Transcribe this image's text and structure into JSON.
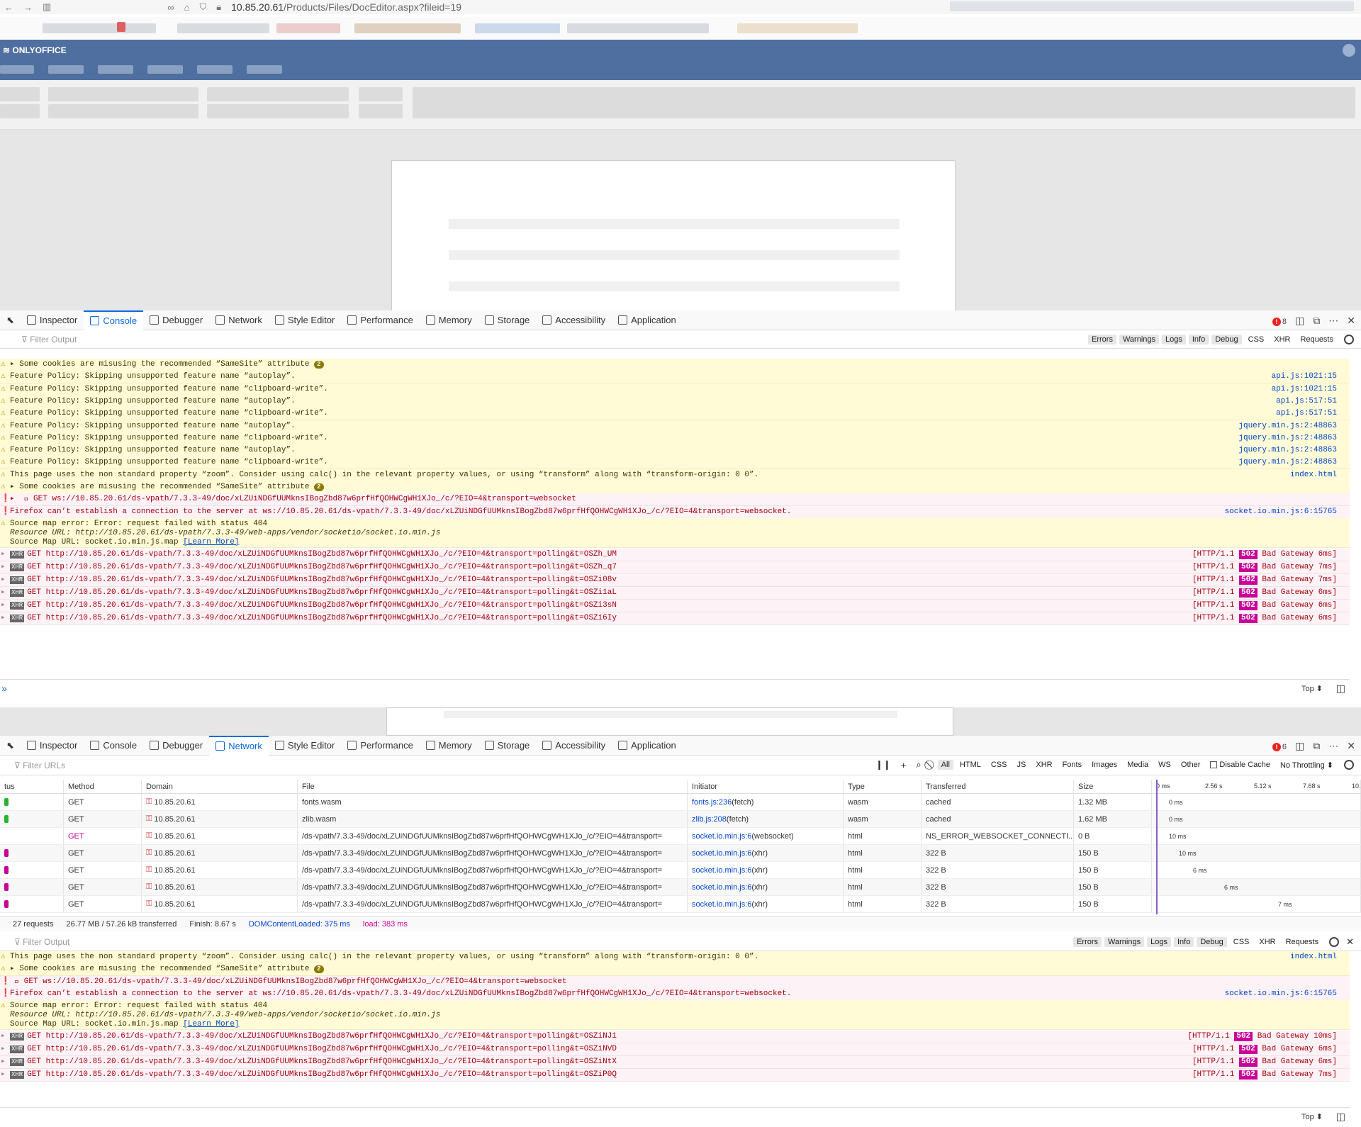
{
  "browser": {
    "url_host": "10.85.20.61",
    "url_path": "/Products/Files/DocEditor.aspx?fileid=19"
  },
  "app": {
    "brand": "ONLYOFFICE"
  },
  "devtools_tabs": [
    {
      "label": "Inspector",
      "icon": "inspector-icon"
    },
    {
      "label": "Console",
      "icon": "console-icon"
    },
    {
      "label": "Debugger",
      "icon": "debugger-icon"
    },
    {
      "label": "Network",
      "icon": "network-icon"
    },
    {
      "label": "Style Editor",
      "icon": "style-editor-icon"
    },
    {
      "label": "Performance",
      "icon": "performance-icon"
    },
    {
      "label": "Memory",
      "icon": "memory-icon"
    },
    {
      "label": "Storage",
      "icon": "storage-icon"
    },
    {
      "label": "Accessibility",
      "icon": "accessibility-icon"
    },
    {
      "label": "Application",
      "icon": "application-icon"
    }
  ],
  "console1": {
    "error_count": "8",
    "filter_placeholder": "Filter Output",
    "filter_buttons": [
      "Errors",
      "Warnings",
      "Logs",
      "Info",
      "Debug"
    ],
    "filter_plain": [
      "CSS",
      "XHR",
      "Requests"
    ],
    "rows": [
      {
        "type": "warn",
        "text": "▸ Some cookies are misusing the recommended “SameSite” attribute ",
        "badge": "2",
        "src": ""
      },
      {
        "type": "warn",
        "text": "Feature Policy: Skipping unsupported feature name “autoplay”.",
        "src": "api.js:1021:15"
      },
      {
        "type": "warn",
        "text": "Feature Policy: Skipping unsupported feature name “clipboard-write”.",
        "src": "api.js:1021:15"
      },
      {
        "type": "warn",
        "text": "Feature Policy: Skipping unsupported feature name “autoplay”.",
        "src": "api.js:517:51"
      },
      {
        "type": "warn",
        "text": "Feature Policy: Skipping unsupported feature name “clipboard-write”.",
        "src": "api.js:517:51"
      },
      {
        "type": "warn",
        "text": "Feature Policy: Skipping unsupported feature name “autoplay”.",
        "src": "jquery.min.js:2:48863"
      },
      {
        "type": "warn",
        "text": "Feature Policy: Skipping unsupported feature name “clipboard-write”.",
        "src": "jquery.min.js:2:48863"
      },
      {
        "type": "warn",
        "text": "Feature Policy: Skipping unsupported feature name “autoplay”.",
        "src": "jquery.min.js:2:48863"
      },
      {
        "type": "warn",
        "text": "Feature Policy: Skipping unsupported feature name “clipboard-write”.",
        "src": "jquery.min.js:2:48863"
      },
      {
        "type": "warn",
        "text": "This page uses the non standard property “zoom”. Consider using calc() in the relevant property values, or using “transform” along with “transform-origin: 0 0”.",
        "src": "index.html"
      },
      {
        "type": "warn",
        "text": "▸ Some cookies are misusing the recommended “SameSite” attribute ",
        "badge": "2",
        "src": ""
      },
      {
        "type": "err",
        "text": "▸  ⃠ GET ws://10.85.20.61/ds-vpath/7.3.3-49/doc/xLZUiNDGfUUMknsIBogZbd87w6prfHfQOHWCgWH1XJo_/c/?EIO=4&transport=websocket",
        "src": ""
      },
      {
        "type": "err",
        "text": "Firefox can’t establish a connection to the server at ws://10.85.20.61/ds-vpath/7.3.3-49/doc/xLZUiNDGfUUMknsIBogZbd87w6prfHfQOHWCgWH1XJo_/c/?EIO=4&transport=websocket.",
        "src": "socket.io.min.js:6:15765"
      }
    ],
    "sourcemap": {
      "l1": "Source map error: Error: request failed with status 404",
      "l2": "Resource URL: http://10.85.20.61/ds-vpath/7.3.3-49/web-apps/vendor/socketio/socket.io.min.js",
      "l3": "Source Map URL: socket.io.min.js.map ",
      "learn": "[Learn More]"
    },
    "xhr": [
      {
        "url": "GET http://10.85.20.61/ds-vpath/7.3.3-49/doc/xLZUiNDGfUUMknsIBogZbd87w6prfHfQOHWCgWH1XJo_/c/?EIO=4&transport=polling&t=OSZh_UM",
        "status": "[HTTP/1.1 ",
        "code": "502",
        "tail": " Bad Gateway 6ms]"
      },
      {
        "url": "GET http://10.85.20.61/ds-vpath/7.3.3-49/doc/xLZUiNDGfUUMknsIBogZbd87w6prfHfQOHWCgWH1XJo_/c/?EIO=4&transport=polling&t=OSZh_q7",
        "status": "[HTTP/1.1 ",
        "code": "502",
        "tail": " Bad Gateway 7ms]"
      },
      {
        "url": "GET http://10.85.20.61/ds-vpath/7.3.3-49/doc/xLZUiNDGfUUMknsIBogZbd87w6prfHfQOHWCgWH1XJo_/c/?EIO=4&transport=polling&t=OSZi08v",
        "status": "[HTTP/1.1 ",
        "code": "502",
        "tail": " Bad Gateway 7ms]"
      },
      {
        "url": "GET http://10.85.20.61/ds-vpath/7.3.3-49/doc/xLZUiNDGfUUMknsIBogZbd87w6prfHfQOHWCgWH1XJo_/c/?EIO=4&transport=polling&t=OSZi1aL",
        "status": "[HTTP/1.1 ",
        "code": "502",
        "tail": " Bad Gateway 6ms]"
      },
      {
        "url": "GET http://10.85.20.61/ds-vpath/7.3.3-49/doc/xLZUiNDGfUUMknsIBogZbd87w6prfHfQOHWCgWH1XJo_/c/?EIO=4&transport=polling&t=OSZi3sN",
        "status": "[HTTP/1.1 ",
        "code": "502",
        "tail": " Bad Gateway 6ms]"
      },
      {
        "url": "GET http://10.85.20.61/ds-vpath/7.3.3-49/doc/xLZUiNDGfUUMknsIBogZbd87w6prfHfQOHWCgWH1XJo_/c/?EIO=4&transport=polling&t=OSZi6Iy",
        "status": "[HTTP/1.1 ",
        "code": "502",
        "tail": " Bad Gateway 6ms]"
      }
    ],
    "top_label": "Top ⬍"
  },
  "network": {
    "error_count": "6",
    "filter_placeholder": "Filter URLs",
    "type_filters": [
      "All",
      "HTML",
      "CSS",
      "JS",
      "XHR",
      "Fonts",
      "Images",
      "Media",
      "WS",
      "Other"
    ],
    "disable_cache": "Disable Cache",
    "throttling": "No Throttling ⬍",
    "columns": [
      "tus",
      "Method",
      "Domain",
      "File",
      "Initiator",
      "Type",
      "Transferred",
      "Size"
    ],
    "timeline_ticks": [
      "0 ms",
      "2.56 s",
      "5.12 s",
      "7.68 s",
      "10.24"
    ],
    "rows": [
      {
        "method": "GET",
        "domain": "10.85.20.61",
        "file": "fonts.wasm",
        "initiator": "fonts.js:236",
        "initiator_kind": " (fetch)",
        "type": "wasm",
        "transferred": "cached",
        "size": "1.32 MB",
        "time": "0 ms",
        "status_color": "#2cb32c"
      },
      {
        "method": "GET",
        "domain": "10.85.20.61",
        "file": "zlib.wasm",
        "initiator": "zlib.js:208",
        "initiator_kind": " (fetch)",
        "type": "wasm",
        "transferred": "cached",
        "size": "1.62 MB",
        "time": "0 ms",
        "status_color": "#2cb32c"
      },
      {
        "method": "GET",
        "domain": "10.85.20.61",
        "file": "/ds-vpath/7.3.3-49/doc/xLZUiNDGfUUMknsIBogZbd87w6prfHfQOHWCgWH1XJo_/c/?EIO=4&transport=",
        "initiator": "socket.io.min.js:6",
        "initiator_kind": " (websocket)",
        "type": "html",
        "transferred": "NS_ERROR_WEBSOCKET_CONNECTI...",
        "size": "0 B",
        "time": "10 ms",
        "status_color": "",
        "red": true
      },
      {
        "method": "GET",
        "domain": "10.85.20.61",
        "file": "/ds-vpath/7.3.3-49/doc/xLZUiNDGfUUMknsIBogZbd87w6prfHfQOHWCgWH1XJo_/c/?EIO=4&transport=",
        "initiator": "socket.io.min.js:6",
        "initiator_kind": " (xhr)",
        "type": "html",
        "transferred": "322 B",
        "size": "150 B",
        "time": "10 ms",
        "status_color": "#c80099"
      },
      {
        "method": "GET",
        "domain": "10.85.20.61",
        "file": "/ds-vpath/7.3.3-49/doc/xLZUiNDGfUUMknsIBogZbd87w6prfHfQOHWCgWH1XJo_/c/?EIO=4&transport=",
        "initiator": "socket.io.min.js:6",
        "initiator_kind": " (xhr)",
        "type": "html",
        "transferred": "322 B",
        "size": "150 B",
        "time": "6 ms",
        "status_color": "#c80099"
      },
      {
        "method": "GET",
        "domain": "10.85.20.61",
        "file": "/ds-vpath/7.3.3-49/doc/xLZUiNDGfUUMknsIBogZbd87w6prfHfQOHWCgWH1XJo_/c/?EIO=4&transport=",
        "initiator": "socket.io.min.js:6",
        "initiator_kind": " (xhr)",
        "type": "html",
        "transferred": "322 B",
        "size": "150 B",
        "time": "6 ms",
        "status_color": "#c80099"
      },
      {
        "method": "GET",
        "domain": "10.85.20.61",
        "file": "/ds-vpath/7.3.3-49/doc/xLZUiNDGfUUMknsIBogZbd87w6prfHfQOHWCgWH1XJo_/c/?EIO=4&transport=",
        "initiator": "socket.io.min.js:6",
        "initiator_kind": " (xhr)",
        "type": "html",
        "transferred": "322 B",
        "size": "150 B",
        "time": "7 ms",
        "status_color": "#c80099"
      }
    ],
    "summary": {
      "requests": "27 requests",
      "transferred": "26.77 MB / 57.26 kB transferred",
      "finish": "Finish: 8.67 s",
      "dcl": "DOMContentLoaded: 375 ms",
      "load": "load: 383 ms"
    }
  },
  "console2": {
    "filter_placeholder": "Filter Output",
    "rows": [
      {
        "type": "warn",
        "text": "This page uses the non standard property “zoom”. Consider using calc() in the relevant property values, or using “transform” along with “transform-origin: 0 0”.",
        "src": "index.html"
      },
      {
        "type": "warn",
        "text": "▸ Some cookies are misusing the recommended “SameSite” attribute ",
        "badge": "2",
        "src": ""
      },
      {
        "type": "err",
        "text": " ⃠ GET ws://10.85.20.61/ds-vpath/7.3.3-49/doc/xLZUiNDGfUUMknsIBogZbd87w6prfHfQOHWCgWH1XJo_/c/?EIO=4&transport=websocket",
        "src": ""
      },
      {
        "type": "err",
        "text": "Firefox can’t establish a connection to the server at ws://10.85.20.61/ds-vpath/7.3.3-49/doc/xLZUiNDGfUUMknsIBogZbd87w6prfHfQOHWCgWH1XJo_/c/?EIO=4&transport=websocket.",
        "src": "socket.io.min.js:6:15765"
      }
    ],
    "sourcemap": {
      "l1": "Source map error: Error: request failed with status 404",
      "l2": "Resource URL: http://10.85.20.61/ds-vpath/7.3.3-49/web-apps/vendor/socketio/socket.io.min.js",
      "l3": "Source Map URL: socket.io.min.js.map ",
      "learn": "[Learn More]"
    },
    "xhr": [
      {
        "url": "GET http://10.85.20.61/ds-vpath/7.3.3-49/doc/xLZUiNDGfUUMknsIBogZbd87w6prfHfQOHWCgWH1XJo_/c/?EIO=4&transport=polling&t=OSZiNJ1",
        "status": "[HTTP/1.1 ",
        "code": "502",
        "tail": " Bad Gateway 10ms]"
      },
      {
        "url": "GET http://10.85.20.61/ds-vpath/7.3.3-49/doc/xLZUiNDGfUUMknsIBogZbd87w6prfHfQOHWCgWH1XJo_/c/?EIO=4&transport=polling&t=OSZiNVD",
        "status": "[HTTP/1.1 ",
        "code": "502",
        "tail": " Bad Gateway 6ms]"
      },
      {
        "url": "GET http://10.85.20.61/ds-vpath/7.3.3-49/doc/xLZUiNDGfUUMknsIBogZbd87w6prfHfQOHWCgWH1XJo_/c/?EIO=4&transport=polling&t=OSZiNtX",
        "status": "[HTTP/1.1 ",
        "code": "502",
        "tail": " Bad Gateway 6ms]"
      },
      {
        "url": "GET http://10.85.20.61/ds-vpath/7.3.3-49/doc/xLZUiNDGfUUMknsIBogZbd87w6prfHfQOHWCgWH1XJo_/c/?EIO=4&transport=polling&t=OSZiP0Q",
        "status": "[HTTP/1.1 ",
        "code": "502",
        "tail": " Bad Gateway 7ms]"
      }
    ],
    "top_label": "Top ⬍"
  },
  "colors": {
    "accent": "#0a6ae0",
    "header": "#4f6fa0",
    "error": "#e22222",
    "warning_bg": "#fffbd6",
    "error_bg": "#fdf2f5",
    "status_502": "#c80099"
  }
}
